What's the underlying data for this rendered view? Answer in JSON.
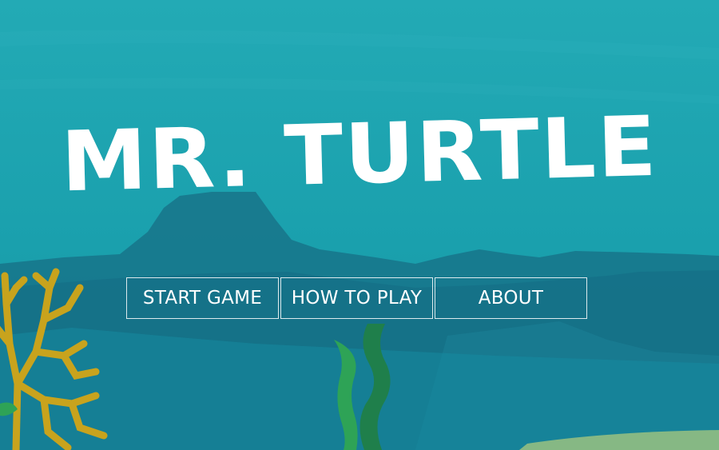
{
  "game": {
    "title": "MR. TURTLE",
    "menu": [
      {
        "label": "START GAME"
      },
      {
        "label": "HOW TO PLAY"
      },
      {
        "label": "ABOUT"
      }
    ]
  },
  "colors": {
    "water_top": "#1ea7b1",
    "water_bottom": "#1690a0",
    "mountain": "#176a83",
    "coral": "#c8a31d",
    "seaweed_dark": "#1f7f4b",
    "seaweed_light": "#2ea356",
    "sand": "#86b884",
    "text": "#ffffff"
  }
}
